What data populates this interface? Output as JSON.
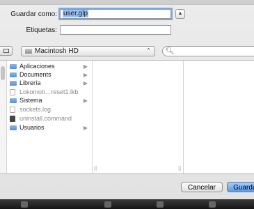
{
  "form": {
    "save_as_label": "Guardar como:",
    "file_name": "user.glp",
    "tags_label": "Etiquetas:",
    "tags_value": ""
  },
  "toolbar": {
    "location": "Macintosh HD",
    "search_value": ""
  },
  "browser": {
    "items": [
      {
        "label": "Aplicaciones",
        "icon": "folder-icon",
        "has_children": true,
        "dim": false
      },
      {
        "label": "Documents",
        "icon": "folder-icon",
        "has_children": true,
        "dim": false
      },
      {
        "label": "Librería",
        "icon": "folder-icon",
        "has_children": true,
        "dim": false
      },
      {
        "label": "Lokomoti…reset1.lkb",
        "icon": "file-icon",
        "has_children": false,
        "dim": true
      },
      {
        "label": "Sistema",
        "icon": "folder-icon",
        "has_children": true,
        "dim": false
      },
      {
        "label": "sockets.log",
        "icon": "file-icon",
        "has_children": false,
        "dim": true
      },
      {
        "label": "uninstall.command",
        "icon": "executable-icon",
        "has_children": false,
        "dim": true
      },
      {
        "label": "Usuarios",
        "icon": "folder-icon",
        "has_children": true,
        "dim": false
      }
    ]
  },
  "buttons": {
    "cancel": "Cancelar",
    "save": "Guardar"
  },
  "colors": {
    "focus_ring": "#7aa7e8",
    "default_button": "#5d9ae6",
    "folder": "#5d8fcf"
  }
}
